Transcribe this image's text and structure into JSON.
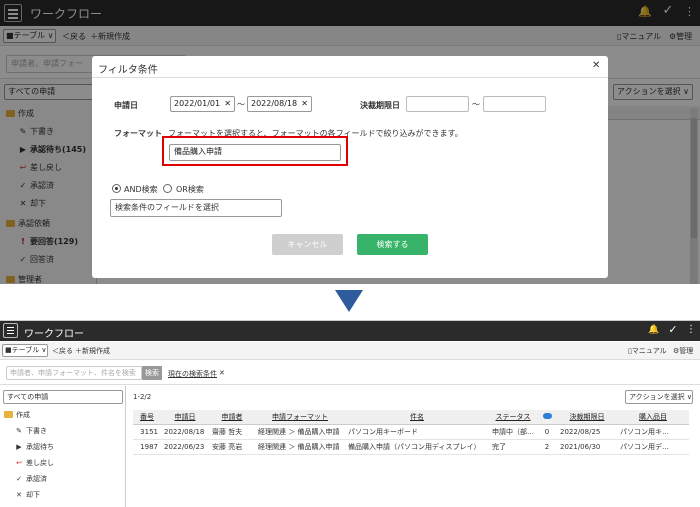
{
  "app": {
    "title": "ワークフロー",
    "icons": {
      "menu": "hamburger-icon",
      "bell": "bell-icon",
      "check": "checkmark-icon",
      "more": "vertical-dots-icon"
    }
  },
  "toolbar": {
    "view_select": "■テーブル ∨",
    "back": "＜戻る",
    "new": "＋新規作成",
    "manual": "マニュアル",
    "admin": "管理"
  },
  "search": {
    "placeholder": "申請者、申請フォーマット、件名を検索",
    "placeholder_top": "申請者、申請フォー",
    "button": "検索",
    "current_condition": "現在の検索条件",
    "clear_mark": "✕"
  },
  "sidebar": {
    "select_value": "すべての申請",
    "groups": {
      "sakusei": "作成",
      "shonin_irai": "承認依頼",
      "kanri": "管理者"
    },
    "top_items": [
      {
        "mark": "✎",
        "label": "下書き"
      },
      {
        "mark": "▶",
        "label": "承認待ち(145)"
      },
      {
        "mark": "↩",
        "label": "差し戻し"
      },
      {
        "mark": "✓",
        "label": "承認済"
      },
      {
        "mark": "✕",
        "label": "却下"
      }
    ],
    "top_requests": [
      {
        "mark": "!",
        "label": "要回答(129)"
      },
      {
        "mark": "✓",
        "label": "回答済"
      }
    ],
    "bottom_items": [
      {
        "mark": "✎",
        "label": "下書き"
      },
      {
        "mark": "▶",
        "label": "承認待ち"
      },
      {
        "mark": "↩",
        "label": "差し戻し"
      },
      {
        "mark": "✓",
        "label": "承認済"
      },
      {
        "mark": "✕",
        "label": "却下"
      }
    ]
  },
  "main": {
    "action_select": "アクションを選択 ∨",
    "count": "1-2/2",
    "columns": [
      "番号",
      "申請日",
      "申請者",
      "申請フォーマット",
      "件名",
      "ステータス",
      "",
      "決裁期限日",
      "購入品目"
    ],
    "comment_icon": "comment-bubble-icon",
    "rows": [
      [
        "3151",
        "2022/08/18",
        "齋藤 哲夫",
        "経理関連 ＞ 備品購入申請",
        "パソコン用キーボード",
        "申請中（部…",
        "0",
        "2022/08/25",
        "パソコン用キ…"
      ],
      [
        "1987",
        "2022/06/23",
        "安藤 亮岩",
        "経理関連 ＞ 備品購入申請",
        "備品購入申請（パソコン用ディスプレイ）",
        "完了",
        "2",
        "2021/06/30",
        "パソコン用デ…"
      ]
    ]
  },
  "modal": {
    "title": "フィルタ条件",
    "close": "✕",
    "apply_date_label": "申請日",
    "date_from": "2022/01/01",
    "date_to": "2022/08/18",
    "tilde": "～",
    "deadline_label": "決裁期限日",
    "format_label": "フォーマット",
    "format_hint": "フォーマットを選択すると、フォーマットの各フィールドで絞り込みができます。",
    "format_value": "備品購入申請",
    "and_label": "AND検索",
    "or_label": "OR検索",
    "field_select": "検索条件のフィールドを選択",
    "cancel": "キャンセル",
    "search": "検索する",
    "highlight_color": "#e00000"
  }
}
